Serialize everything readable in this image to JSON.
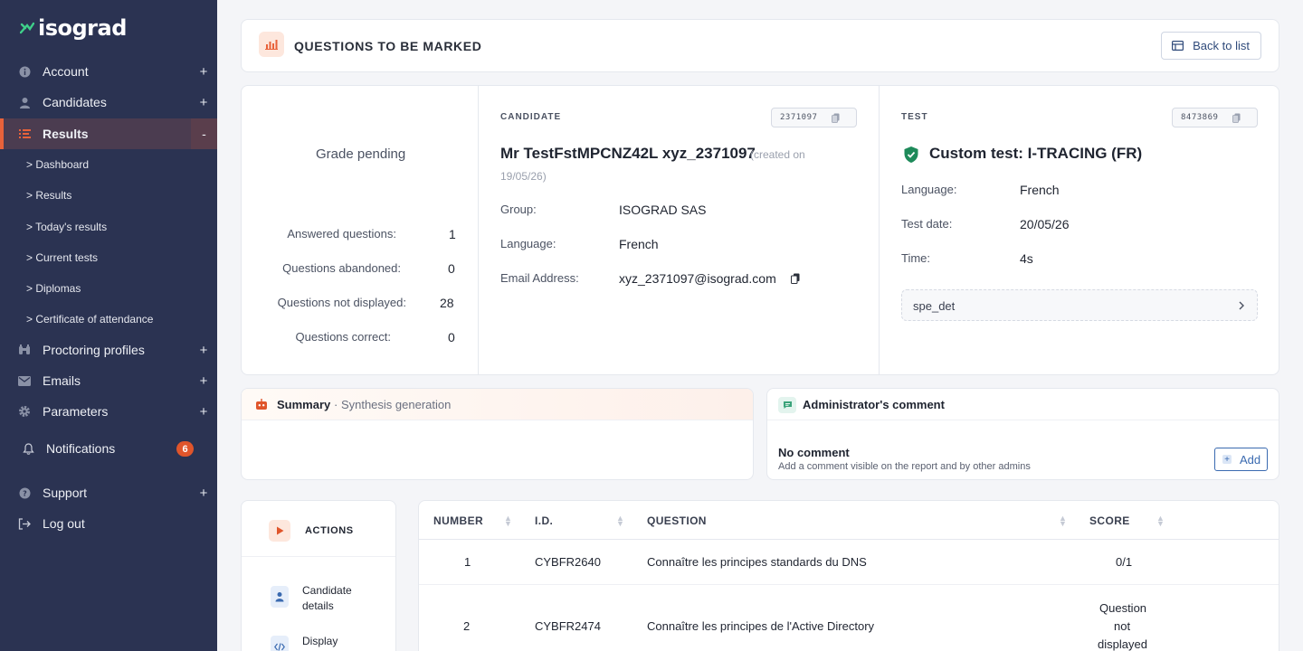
{
  "brand": {
    "name": "isograd"
  },
  "sidebar": {
    "items": [
      {
        "label": "Account",
        "icon": "info-icon",
        "toggle": "+"
      },
      {
        "label": "Candidates",
        "icon": "user-icon",
        "toggle": "+"
      },
      {
        "label": "Results",
        "icon": "list-icon",
        "toggle": "-"
      },
      {
        "label": "Proctoring profiles",
        "icon": "binoculars-icon",
        "toggle": "+"
      },
      {
        "label": "Emails",
        "icon": "mail-icon",
        "toggle": "+"
      },
      {
        "label": "Parameters",
        "icon": "gear-icon",
        "toggle": "+"
      },
      {
        "label": "Notifications",
        "icon": "bell-icon",
        "badge": "6"
      },
      {
        "label": "Support",
        "icon": "help-icon",
        "toggle": "+"
      },
      {
        "label": "Log out",
        "icon": "logout-icon"
      }
    ],
    "results_sub": [
      "> Dashboard",
      "> Results",
      "> Today's results",
      "> Current tests",
      "> Diplomas",
      "> Certificate of attendance"
    ]
  },
  "header": {
    "title": "QUESTIONS TO BE MARKED",
    "back_label": "Back to list"
  },
  "grade": {
    "status": "Grade pending",
    "stats": [
      {
        "label": "Answered questions:",
        "value": "1"
      },
      {
        "label": "Questions abandoned:",
        "value": "0"
      },
      {
        "label": "Questions not displayed:",
        "value": "28"
      },
      {
        "label": "Questions correct:",
        "value": "0"
      }
    ]
  },
  "candidate": {
    "section": "CANDIDATE",
    "id": "2371097",
    "name": "Mr TestFstMPCNZ42L xyz_2371097",
    "created_prefix": "(created on",
    "created_date": "19/05/26)",
    "fields": [
      {
        "label": "Group:",
        "value": "ISOGRAD SAS"
      },
      {
        "label": "Language:",
        "value": "French"
      },
      {
        "label": "Email Address:",
        "value": "xyz_2371097@isograd.com"
      }
    ]
  },
  "test": {
    "section": "TEST",
    "id": "8473869",
    "name": "Custom test: I-TRACING (FR)",
    "fields": [
      {
        "label": "Language:",
        "value": "French"
      },
      {
        "label": "Test date:",
        "value": "20/05/26"
      },
      {
        "label": "Time:",
        "value": "4s"
      }
    ],
    "detail_link": "spe_det"
  },
  "summary": {
    "title": "Summary",
    "subtitle": "· Synthesis generation"
  },
  "comment": {
    "title": "Administrator's comment",
    "empty_title": "No comment",
    "empty_desc": "Add a comment visible on the report and by other admins",
    "add_label": "Add"
  },
  "actions": {
    "title": "ACTIONS",
    "items": [
      {
        "label_line1": "Candidate",
        "label_line2": "details"
      },
      {
        "label_line1": "Display",
        "label_line2": ""
      }
    ]
  },
  "table": {
    "headers": [
      "NUMBER",
      "I.D.",
      "QUESTION",
      "SCORE"
    ],
    "rows": [
      {
        "number": "1",
        "id": "CYBFR2640",
        "question": "Connaître les principes standards du DNS",
        "score": "0/1"
      },
      {
        "number": "2",
        "id": "CYBFR2474",
        "question": "Connaître les principes de l'Active Directory",
        "score_lines": [
          "Question",
          "not",
          "displayed"
        ]
      }
    ]
  },
  "colors": {
    "sidebar_bg": "#2b3352",
    "accent": "#e8623a",
    "badge": "#e0552b",
    "link": "#2f4a7a"
  }
}
